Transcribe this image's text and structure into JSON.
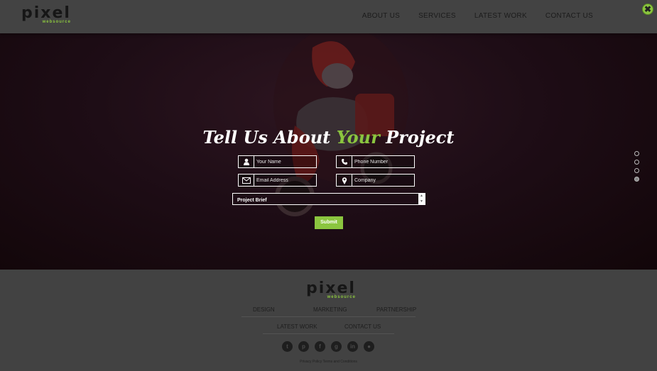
{
  "header": {
    "logo_text": "pixel",
    "logo_sub": "websource",
    "nav": [
      "ABOUT US",
      "SERVICES",
      "LATEST WORK",
      "CONTACT US"
    ],
    "close_icon": "close-circle-icon"
  },
  "hero": {
    "title_part1": "Tell Us About ",
    "title_highlight": "Your",
    "title_part2": " Project",
    "fields": {
      "name": {
        "placeholder": "Your Name",
        "icon": "user-icon"
      },
      "phone": {
        "placeholder": "Phone Number",
        "icon": "phone-icon"
      },
      "email": {
        "placeholder": "Email Address",
        "icon": "envelope-icon"
      },
      "company": {
        "placeholder": "Company",
        "icon": "location-pin-icon"
      }
    },
    "brief_placeholder": "Project Brief",
    "submit_label": "Submit",
    "slide_count": 4,
    "active_slide": 4
  },
  "footer": {
    "logo_text": "pixel",
    "logo_sub": "websource",
    "nav_row1": [
      "DESIGN",
      "MARKETING",
      "PARTNERSHIP"
    ],
    "nav_row2": [
      "LATEST WORK",
      "CONTACT US"
    ],
    "social_icons": [
      "twitter-icon",
      "pinterest-icon",
      "facebook-icon",
      "google-plus-icon",
      "linkedin-icon",
      "globe-icon"
    ],
    "legal": "Privacy Policy  Terms and Conditions"
  },
  "colors": {
    "accent": "#8bc53f",
    "header_bg": "#434343",
    "hero_bg": "#1e0d16",
    "footer_bg": "#424242"
  }
}
